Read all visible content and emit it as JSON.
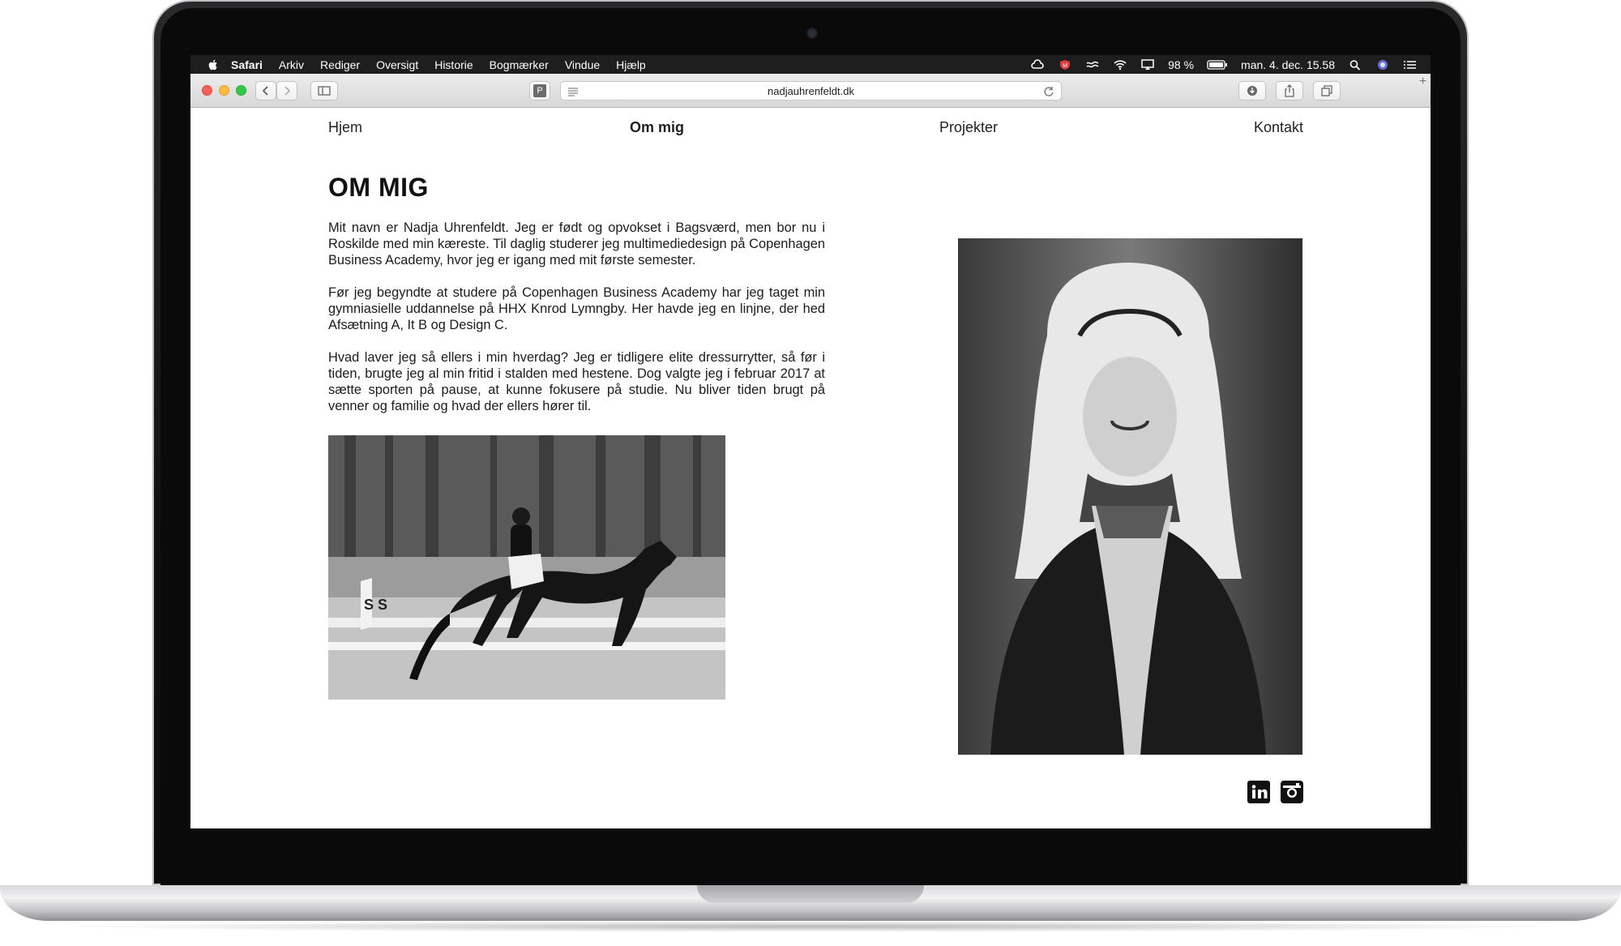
{
  "menubar": {
    "app_name": "Safari",
    "menus": [
      "Arkiv",
      "Rediger",
      "Oversigt",
      "Historie",
      "Bogmærker",
      "Vindue",
      "Hjælp"
    ],
    "battery": "98 %",
    "datetime": "man. 4. dec. 15.58"
  },
  "browser": {
    "url": "nadjauhrenfeldt.dk",
    "reader_badge": "P",
    "new_tab": "+"
  },
  "site": {
    "nav": {
      "home": "Hjem",
      "about": "Om mig",
      "projects": "Projekter",
      "contact": "Kontakt"
    },
    "title": "OM MIG",
    "paragraphs": [
      "Mit navn er Nadja Uhrenfeldt. Jeg er født og opvokset i Bagsværd, men bor nu i Roskilde med min kæreste. Til daglig studerer jeg multimediedesign på Copenhagen Business Academy, hvor jeg er igang med mit første semester.",
      "Før jeg begyndte at studere på Copenhagen Business Academy har jeg taget min gymniasielle uddannelse på HHX Knrod Lymngby. Her havde jeg en linjne, der hed Afsætning A, It B og Design C.",
      "Hvad laver jeg så ellers i min hverdag? Jeg er tidligere elite dressurrytter, så før i tiden, brugte jeg al min fritid i stalden med hestene. Dog valgte jeg i februar 2017 at sætte sporten på pause, at kunne fokusere på studie. Nu bliver tiden brugt på venner og familie og hvad der ellers hører til."
    ],
    "arena_marker": "S S"
  },
  "colors": {
    "menubar_bg": "#1e1e1e",
    "close": "#fc605c",
    "minimize": "#fdbc40",
    "zoom": "#34c84a"
  }
}
